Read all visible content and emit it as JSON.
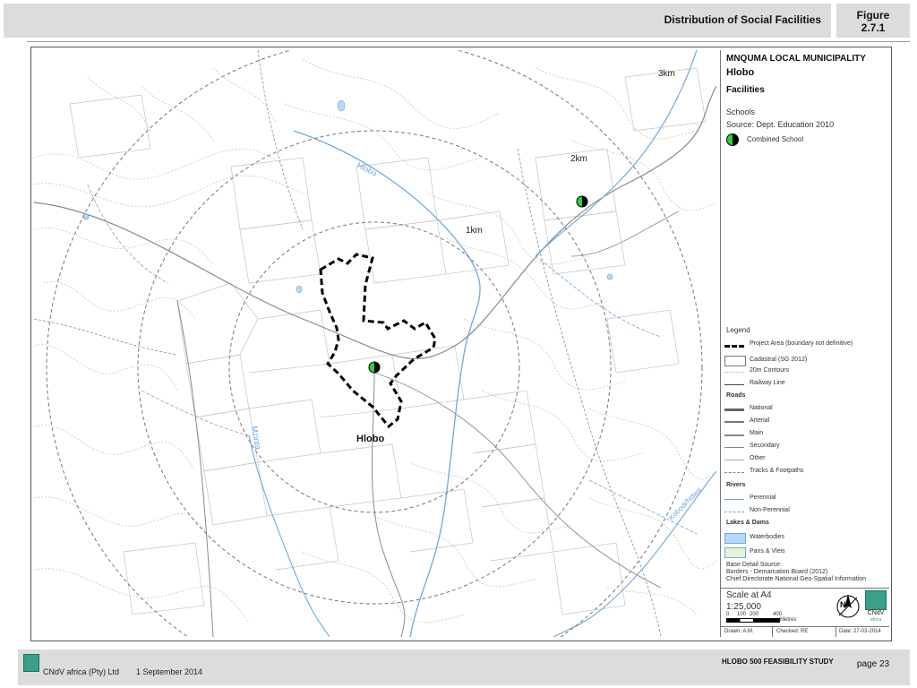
{
  "header": {
    "title": "Distribution of Social Facilities",
    "figure_label": "Figure",
    "figure_number": "2.7.1"
  },
  "map": {
    "labels": {
      "ring_3km": "3km",
      "ring_2km": "2km",
      "ring_1km": "1km",
      "place": "Hlobo",
      "river_hlobo": "Hlobo",
      "river_mzinta": "Mzinta",
      "river_kobodi": "Kobodi/Ndwa"
    },
    "colors": {
      "contour": "#d8c69a",
      "river": "#6fa8dc",
      "road": "#8a8a8a",
      "cadastral": "#bdbdbd",
      "school_fill": "#2ecc40",
      "boundary": "#000000"
    }
  },
  "panel": {
    "municipality": "MNQUMA LOCAL MUNICIPALITY",
    "area": "Hlobo",
    "section": "Facilities",
    "schools_heading": "Schools",
    "schools_source": "Source: Dept. Education 2010",
    "combined_school": "Combined School",
    "legend_title": "Legend",
    "legend": {
      "project_area": "Project Area (boundary not definitive)",
      "cadastral": "Cadastral (SG 2012)",
      "contours": "20m Contours",
      "railway": "Railway Line",
      "roads_heading": "Roads",
      "national": "National",
      "arterial": "Arterial",
      "main": "Main",
      "secondary": "Secondary",
      "other": "Other",
      "tracks": "Tracks & Footpaths",
      "rivers_heading": "Rivers",
      "perennial": "Perennial",
      "non_perennial": "Non-Perennial",
      "lakes_heading": "Lakes & Dams",
      "waterbodies": "Waterbodies",
      "pans": "Pans & Vleis"
    },
    "base_source_title": "Base Detail Source:",
    "base_source_1": "Borders - Demarcation Board (2012)",
    "base_source_2": "Chief Directorate National Geo-Spatial Information",
    "scale_title": "Scale at A4",
    "scale_ratio": "1:25,000",
    "scale_ticks": [
      "0",
      "100",
      "200",
      "400"
    ],
    "scale_unit": "Metres",
    "north": "N",
    "logo_name": "CNdV",
    "logo_sub": "africa",
    "drawn": "Drawn: A.M.",
    "checked": "Checked: RE",
    "date": "Date: 27-03-2014"
  },
  "footer": {
    "company": "CNdV africa (Pty) Ltd",
    "date": "1 September 2014",
    "study": "HLOBO 500 FEASIBILITY STUDY",
    "page": "page 23"
  }
}
